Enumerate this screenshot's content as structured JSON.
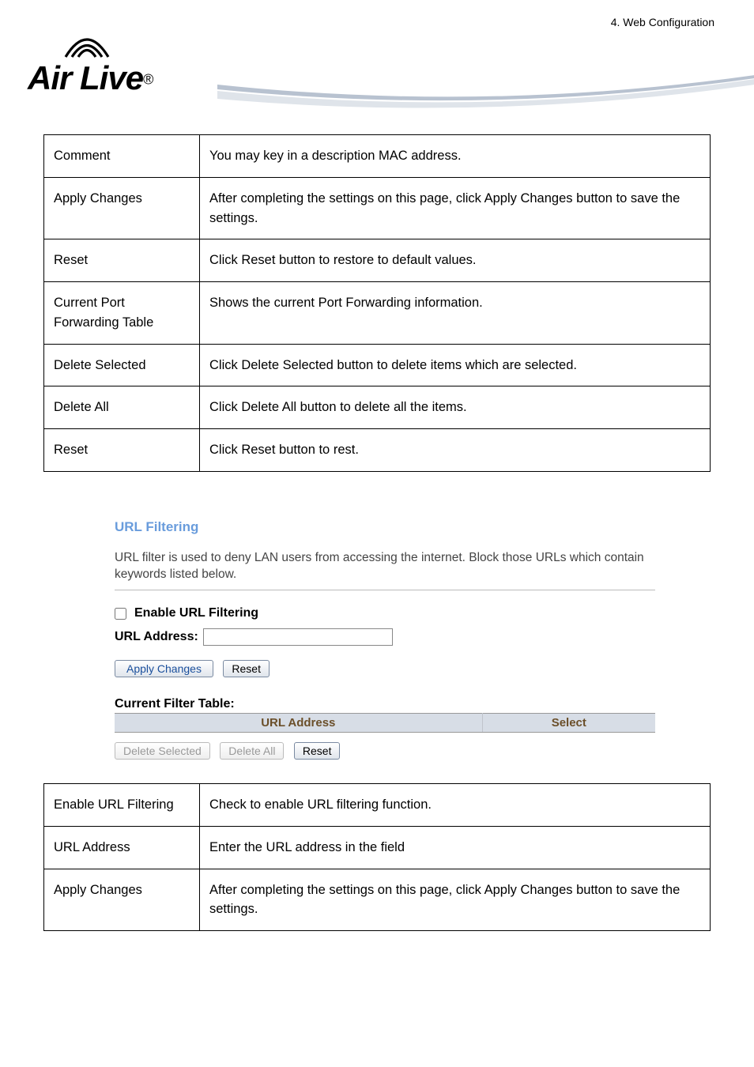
{
  "page": {
    "chapter": "4. Web  Configuration",
    "logo_text": "Air Live",
    "logo_reg": "®"
  },
  "table1": {
    "rows": [
      {
        "key": "Comment",
        "val": "You may key in a description MAC address."
      },
      {
        "key": "Apply Changes",
        "val": "After completing the settings on this page, click Apply Changes button to save the settings."
      },
      {
        "key": "Reset",
        "val": "Click Reset button to restore to default values."
      },
      {
        "key": "Current Port Forwarding Table",
        "val": "Shows the current Port Forwarding information."
      },
      {
        "key": "Delete Selected",
        "val": "Click Delete Selected button to delete items which are selected."
      },
      {
        "key": "Delete All",
        "val": "Click Delete All button to delete all the items."
      },
      {
        "key": "Reset",
        "val": "Click Reset button to rest."
      }
    ]
  },
  "router": {
    "heading": "URL Filtering",
    "desc": "URL filter is used to deny LAN users from accessing the internet. Block those URLs which contain keywords listed below.",
    "enable_label": "Enable URL Filtering",
    "url_label": "URL Address:",
    "url_value": "",
    "apply_btn": "Apply Changes",
    "reset_btn": "Reset",
    "cft_label": "Current Filter Table:",
    "th_url": "URL Address",
    "th_select": "Select",
    "del_selected": "Delete Selected",
    "del_all": "Delete All",
    "reset2": "Reset"
  },
  "table2": {
    "rows": [
      {
        "key": "Enable URL Filtering",
        "val": "Check to enable URL filtering function."
      },
      {
        "key": "URL Address",
        "val": "Enter the URL address in the field"
      },
      {
        "key": "Apply Changes",
        "val": "After completing the settings on this page, click Apply Changes button to save the settings."
      }
    ]
  }
}
